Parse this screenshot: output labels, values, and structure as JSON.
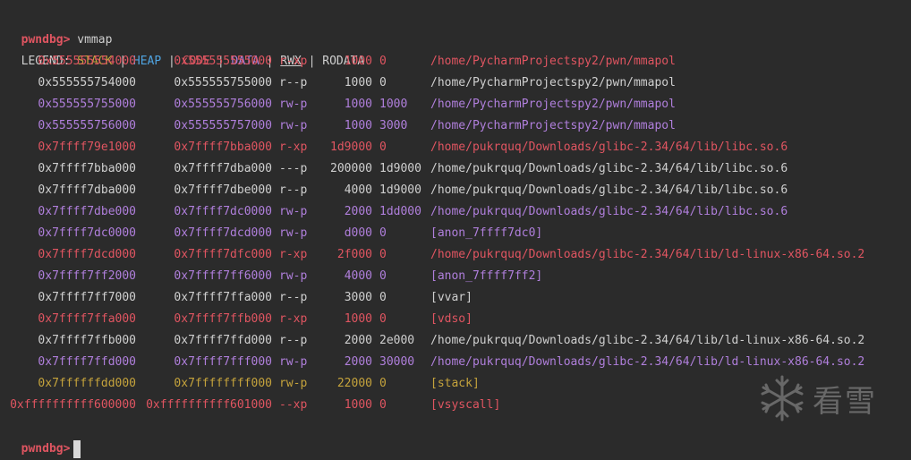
{
  "prompt": "pwndbg>",
  "command": "vmmap",
  "legend": {
    "label": "LEGEND:",
    "items": [
      "STACK",
      "HEAP",
      "CODE",
      "DATA",
      "RWX",
      "RODATA"
    ],
    "separator": "|"
  },
  "rows": [
    {
      "start": "0x555555554000",
      "end": "0x555555555000",
      "perms": "r-xp",
      "size": "1000",
      "offset": "0",
      "file": "/home/PycharmProjectspy2/pwn/mmapol",
      "color": "red"
    },
    {
      "start": "0x555555754000",
      "end": "0x555555755000",
      "perms": "r--p",
      "size": "1000",
      "offset": "0",
      "file": "/home/PycharmProjectspy2/pwn/mmapol",
      "color": "white"
    },
    {
      "start": "0x555555755000",
      "end": "0x555555756000",
      "perms": "rw-p",
      "size": "1000",
      "offset": "1000",
      "file": "/home/PycharmProjectspy2/pwn/mmapol",
      "color": "purple"
    },
    {
      "start": "0x555555756000",
      "end": "0x555555757000",
      "perms": "rw-p",
      "size": "1000",
      "offset": "3000",
      "file": "/home/PycharmProjectspy2/pwn/mmapol",
      "color": "purple"
    },
    {
      "start": "0x7ffff79e1000",
      "end": "0x7ffff7bba000",
      "perms": "r-xp",
      "size": "1d9000",
      "offset": "0",
      "file": "/home/pukrquq/Downloads/glibc-2.34/64/lib/libc.so.6",
      "color": "red"
    },
    {
      "start": "0x7ffff7bba000",
      "end": "0x7ffff7dba000",
      "perms": "---p",
      "size": "200000",
      "offset": "1d9000",
      "file": "/home/pukrquq/Downloads/glibc-2.34/64/lib/libc.so.6",
      "color": "white"
    },
    {
      "start": "0x7ffff7dba000",
      "end": "0x7ffff7dbe000",
      "perms": "r--p",
      "size": "4000",
      "offset": "1d9000",
      "file": "/home/pukrquq/Downloads/glibc-2.34/64/lib/libc.so.6",
      "color": "white"
    },
    {
      "start": "0x7ffff7dbe000",
      "end": "0x7ffff7dc0000",
      "perms": "rw-p",
      "size": "2000",
      "offset": "1dd000",
      "file": "/home/pukrquq/Downloads/glibc-2.34/64/lib/libc.so.6",
      "color": "purple"
    },
    {
      "start": "0x7ffff7dc0000",
      "end": "0x7ffff7dcd000",
      "perms": "rw-p",
      "size": "d000",
      "offset": "0",
      "file": "[anon_7ffff7dc0]",
      "color": "purple"
    },
    {
      "start": "0x7ffff7dcd000",
      "end": "0x7ffff7dfc000",
      "perms": "r-xp",
      "size": "2f000",
      "offset": "0",
      "file": "/home/pukrquq/Downloads/glibc-2.34/64/lib/ld-linux-x86-64.so.2",
      "color": "red"
    },
    {
      "start": "0x7ffff7ff2000",
      "end": "0x7ffff7ff6000",
      "perms": "rw-p",
      "size": "4000",
      "offset": "0",
      "file": "[anon_7ffff7ff2]",
      "color": "purple"
    },
    {
      "start": "0x7ffff7ff7000",
      "end": "0x7ffff7ffa000",
      "perms": "r--p",
      "size": "3000",
      "offset": "0",
      "file": "[vvar]",
      "color": "white"
    },
    {
      "start": "0x7ffff7ffa000",
      "end": "0x7ffff7ffb000",
      "perms": "r-xp",
      "size": "1000",
      "offset": "0",
      "file": "[vdso]",
      "color": "red"
    },
    {
      "start": "0x7ffff7ffb000",
      "end": "0x7ffff7ffd000",
      "perms": "r--p",
      "size": "2000",
      "offset": "2e000",
      "file": "/home/pukrquq/Downloads/glibc-2.34/64/lib/ld-linux-x86-64.so.2",
      "color": "white"
    },
    {
      "start": "0x7ffff7ffd000",
      "end": "0x7ffff7fff000",
      "perms": "rw-p",
      "size": "2000",
      "offset": "30000",
      "file": "/home/pukrquq/Downloads/glibc-2.34/64/lib/ld-linux-x86-64.so.2",
      "color": "purple"
    },
    {
      "start": "0x7ffffffdd000",
      "end": "0x7ffffffff000",
      "perms": "rw-p",
      "size": "22000",
      "offset": "0",
      "file": "[stack]",
      "color": "yellow"
    },
    {
      "start": "0xffffffffff600000",
      "end": "0xffffffffff601000",
      "perms": "--xp",
      "size": "1000",
      "offset": "0",
      "file": "[vsyscall]",
      "color": "red"
    }
  ],
  "watermark": {
    "text": "看雪",
    "icon": "snowflake-icon"
  }
}
